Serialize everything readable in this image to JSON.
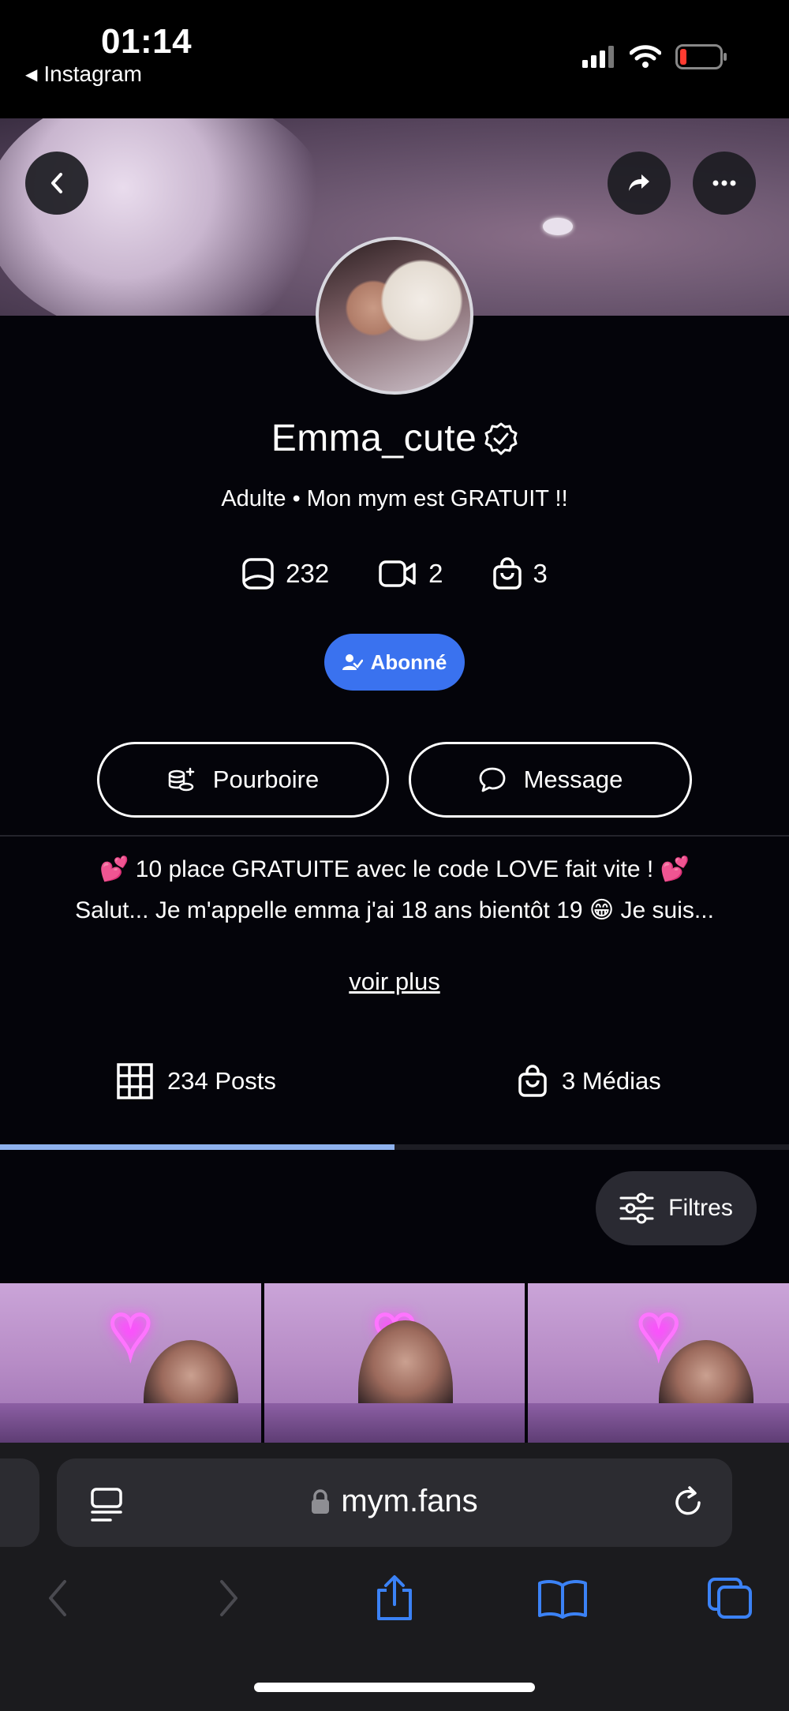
{
  "status_bar": {
    "time": "01:14",
    "back_app": "Instagram"
  },
  "profile": {
    "name": "Emma_cute",
    "bio_line": "Adulte • Mon mym est GRATUIT !!",
    "stats": {
      "photos": "232",
      "videos": "2",
      "shop": "3"
    },
    "subscribe_label": "Abonné"
  },
  "actions": {
    "tip_label": "Pourboire",
    "message_label": "Message"
  },
  "description": {
    "line1": "💕 10 place GRATUITE avec le code LOVE fait vite ! 💕",
    "line2": "Salut... Je m'appelle emma j'ai 18 ans bientôt 19 😁 Je suis...",
    "more_label": "voir plus"
  },
  "tabs": {
    "posts": "234 Posts",
    "media": "3 Médias",
    "active": "posts"
  },
  "filters_label": "Filtres",
  "browser": {
    "url": "mym.fans"
  },
  "colors": {
    "accent": "#3a72ef",
    "tab_indicator": "#8fb2ee",
    "background": "#04040a"
  }
}
